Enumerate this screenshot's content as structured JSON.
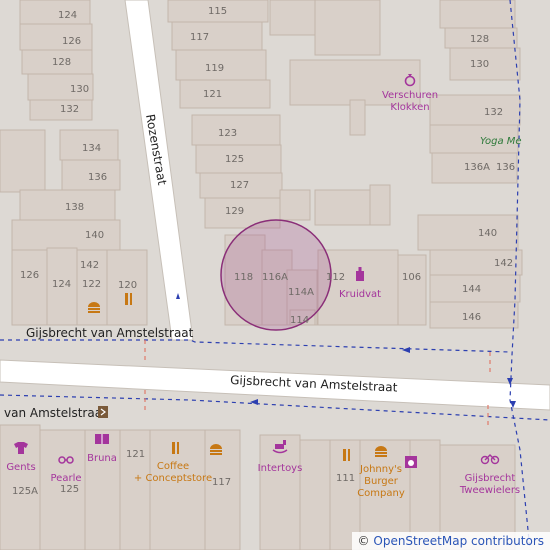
{
  "map": {
    "streets": [
      {
        "id": "main",
        "label": "Gijsbrecht van Amstelstraat"
      },
      {
        "id": "left",
        "label": "Gijsbrecht van Amstelstraat"
      },
      {
        "id": "mid",
        "label": "van Amstelstraat"
      },
      {
        "id": "rozen",
        "label": "Rozenstraat"
      }
    ],
    "house_numbers": [
      "124",
      "126",
      "128",
      "130",
      "132",
      "134",
      "136",
      "138",
      "140",
      "142",
      "126",
      "124",
      "122",
      "120",
      "115",
      "117",
      "119",
      "121",
      "123",
      "125",
      "127",
      "129",
      "118",
      "116A",
      "114A",
      "114",
      "112",
      "106",
      "140",
      "142",
      "144",
      "146",
      "128",
      "130",
      "132",
      "136A",
      "136",
      "121",
      "125A",
      "125",
      "117",
      "111"
    ],
    "pois": [
      {
        "id": "verschuren",
        "label": "Verschuren\nKlokken",
        "icon": "ring-icon"
      },
      {
        "id": "kruidvat",
        "label": "Kruidvat",
        "icon": "perfume-icon"
      },
      {
        "id": "yoga",
        "label": "Yoga Me",
        "icon": "none"
      },
      {
        "id": "gents",
        "label": "Gents",
        "icon": "shirt-icon"
      },
      {
        "id": "pearle",
        "label": "Pearle",
        "icon": "glasses-icon"
      },
      {
        "id": "bruna",
        "label": "Bruna",
        "icon": "book-icon"
      },
      {
        "id": "coffee",
        "label": "Coffee\n+ Conceptstore",
        "icon": "cafe-icon"
      },
      {
        "id": "intertoys",
        "label": "Intertoys",
        "icon": "toy-icon"
      },
      {
        "id": "johnnys",
        "label": "Johnny's\nBurger\nCompany",
        "icon": "burger-icon"
      },
      {
        "id": "gijsbrecht_tw",
        "label": "Gijsbrecht\nTweewielers",
        "icon": "bicycle-icon"
      }
    ],
    "colors": {
      "background": "#ddd9d4",
      "building": "#d9d0c9",
      "building_stroke": "#c4b6ab",
      "road": "#ffffff",
      "road_edge": "#c7c0b8",
      "poi_purple": "#a4359c",
      "poi_orange": "#c77814",
      "highlight_circle": "#a4508f"
    }
  },
  "attribution": {
    "symbol": "©",
    "text": "OpenStreetMap contributors"
  }
}
